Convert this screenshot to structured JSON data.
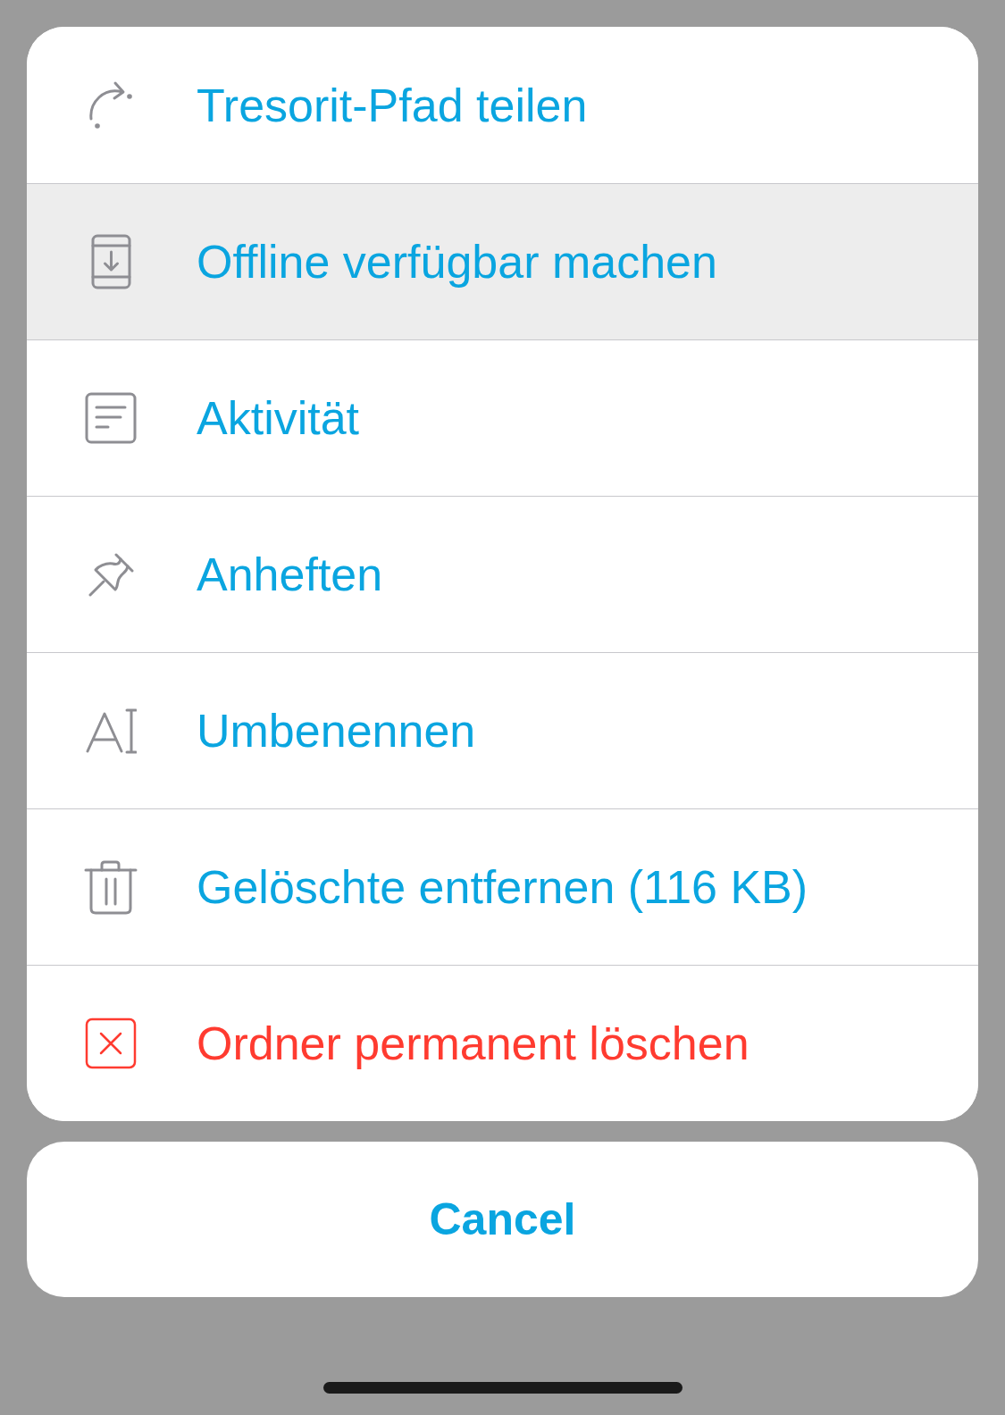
{
  "actions": [
    {
      "label": "Tresorit-Pfad teilen",
      "kind": "normal",
      "selected": false
    },
    {
      "label": "Offline verfügbar machen",
      "kind": "normal",
      "selected": true
    },
    {
      "label": "Aktivität",
      "kind": "normal",
      "selected": false
    },
    {
      "label": "Anheften",
      "kind": "normal",
      "selected": false
    },
    {
      "label": "Umbenennen",
      "kind": "normal",
      "selected": false
    },
    {
      "label": "Gelöschte entfernen (116 KB)",
      "kind": "normal",
      "selected": false
    },
    {
      "label": "Ordner permanent löschen",
      "kind": "destructive",
      "selected": false
    }
  ],
  "cancel": {
    "label": "Cancel"
  }
}
